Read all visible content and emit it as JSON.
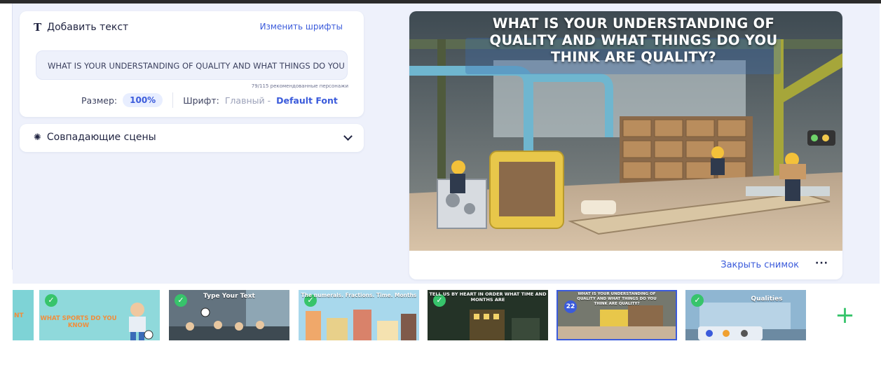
{
  "text_panel": {
    "title": "Добавить текст",
    "change_fonts_label": "Изменить шрифты",
    "text_value": "WHAT IS YOUR UNDERSTANDING OF QUALITY AND WHAT THINGS DO YOU THINK ARE QUALITY?",
    "char_counter": "79/115 рекомендованные персонажи",
    "size_label": "Размер:",
    "size_value": "100%",
    "font_label": "Шрифт:",
    "font_group": "Главный -",
    "font_name": "Default Font"
  },
  "matching_scenes": {
    "title": "Совпадающие сцены"
  },
  "preview": {
    "scene_title": "WHAT IS YOUR UNDERSTANDING OF QUALITY AND WHAT THINGS DO YOU THINK ARE QUALITY?",
    "close_snapshot_label": "Закрыть снимок",
    "more_label": "···"
  },
  "timeline": {
    "partial_thumb_text": "NT",
    "thumbs": [
      {
        "title": "WHAT SPORTS DO YOU KNOW",
        "checked": true
      },
      {
        "title": "Type Your Text",
        "checked": true
      },
      {
        "title": "The numerals. Fractions. Time. Months",
        "checked": true
      },
      {
        "title": "TELL US BY HEART IN ORDER WHAT TIME AND MONTHS ARE",
        "checked": true
      },
      {
        "title": "WHAT IS YOUR UNDERSTANDING OF QUALITY AND WHAT THINGS DO YOU THINK ARE QUALITY?",
        "number": "22",
        "selected": true
      },
      {
        "title": "Qualities",
        "checked": true
      }
    ],
    "add_label": "+"
  },
  "colors": {
    "accent": "#3b5bdb",
    "check": "#37c46b",
    "workspace_bg": "#eef1fb"
  },
  "icons": {
    "text": "t-icon",
    "scenes": "gear-icon",
    "expand": "chevron-down-icon",
    "check": "check-icon",
    "add": "plus-icon"
  }
}
